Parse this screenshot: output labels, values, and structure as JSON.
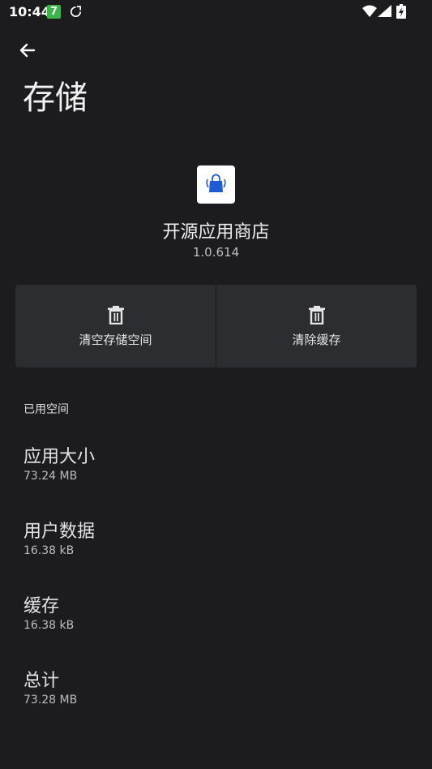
{
  "status_bar": {
    "time": "10:44",
    "badge": "7",
    "icons": [
      "sync-icon",
      "wifi-icon",
      "signal-icon",
      "battery-icon"
    ]
  },
  "page": {
    "title": "存储"
  },
  "app": {
    "name": "开源应用商店",
    "version": "1.0.614"
  },
  "actions": {
    "clear_storage": "清空存储空间",
    "clear_cache": "清除缓存"
  },
  "section": {
    "header": "已用空间"
  },
  "rows": [
    {
      "title": "应用大小",
      "value": "73.24 MB"
    },
    {
      "title": "用户数据",
      "value": "16.38 kB"
    },
    {
      "title": "缓存",
      "value": "16.38 kB"
    },
    {
      "title": "总计",
      "value": "73.28 MB"
    }
  ],
  "colors": {
    "background": "#1c1c1e",
    "panel": "#2c2d30",
    "badge_green": "#3bb54a",
    "app_icon_blue": "#1e5bd6"
  }
}
